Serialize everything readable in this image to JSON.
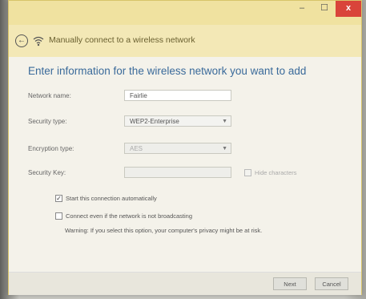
{
  "window": {
    "minimize_glyph": "–",
    "maximize_glyph": "☐",
    "close_glyph": "x"
  },
  "header": {
    "back_glyph": "←",
    "title": "Manually connect to a wireless network"
  },
  "main": {
    "heading": "Enter information for the wireless network you want to add",
    "network_name": {
      "label": "Network name:",
      "value": "Fairlie"
    },
    "security_type": {
      "label": "Security type:",
      "value": "WEP2-Enterprise"
    },
    "encryption_type": {
      "label": "Encryption type:",
      "value": "AES"
    },
    "security_key": {
      "label": "Security Key:",
      "value": ""
    },
    "hide_characters": {
      "label": "Hide characters",
      "checked": false
    },
    "start_automatically": {
      "label": "Start this connection automatically",
      "checked": true
    },
    "connect_not_broadcasting": {
      "label": "Connect even if the network is not broadcasting",
      "checked": false
    },
    "warning": "Warning: If you select this option, your computer's privacy might be at risk."
  },
  "footer": {
    "next_label": "Next",
    "cancel_label": "Cancel"
  },
  "icons": {
    "back": "back-arrow-icon",
    "network": "wireless-network-icon",
    "dropdown": "chevron-down-icon",
    "check": "checkmark-icon"
  },
  "colors": {
    "titlebar": "#f0e2a0",
    "heading": "#3a6a9a",
    "close": "#d9443a"
  }
}
